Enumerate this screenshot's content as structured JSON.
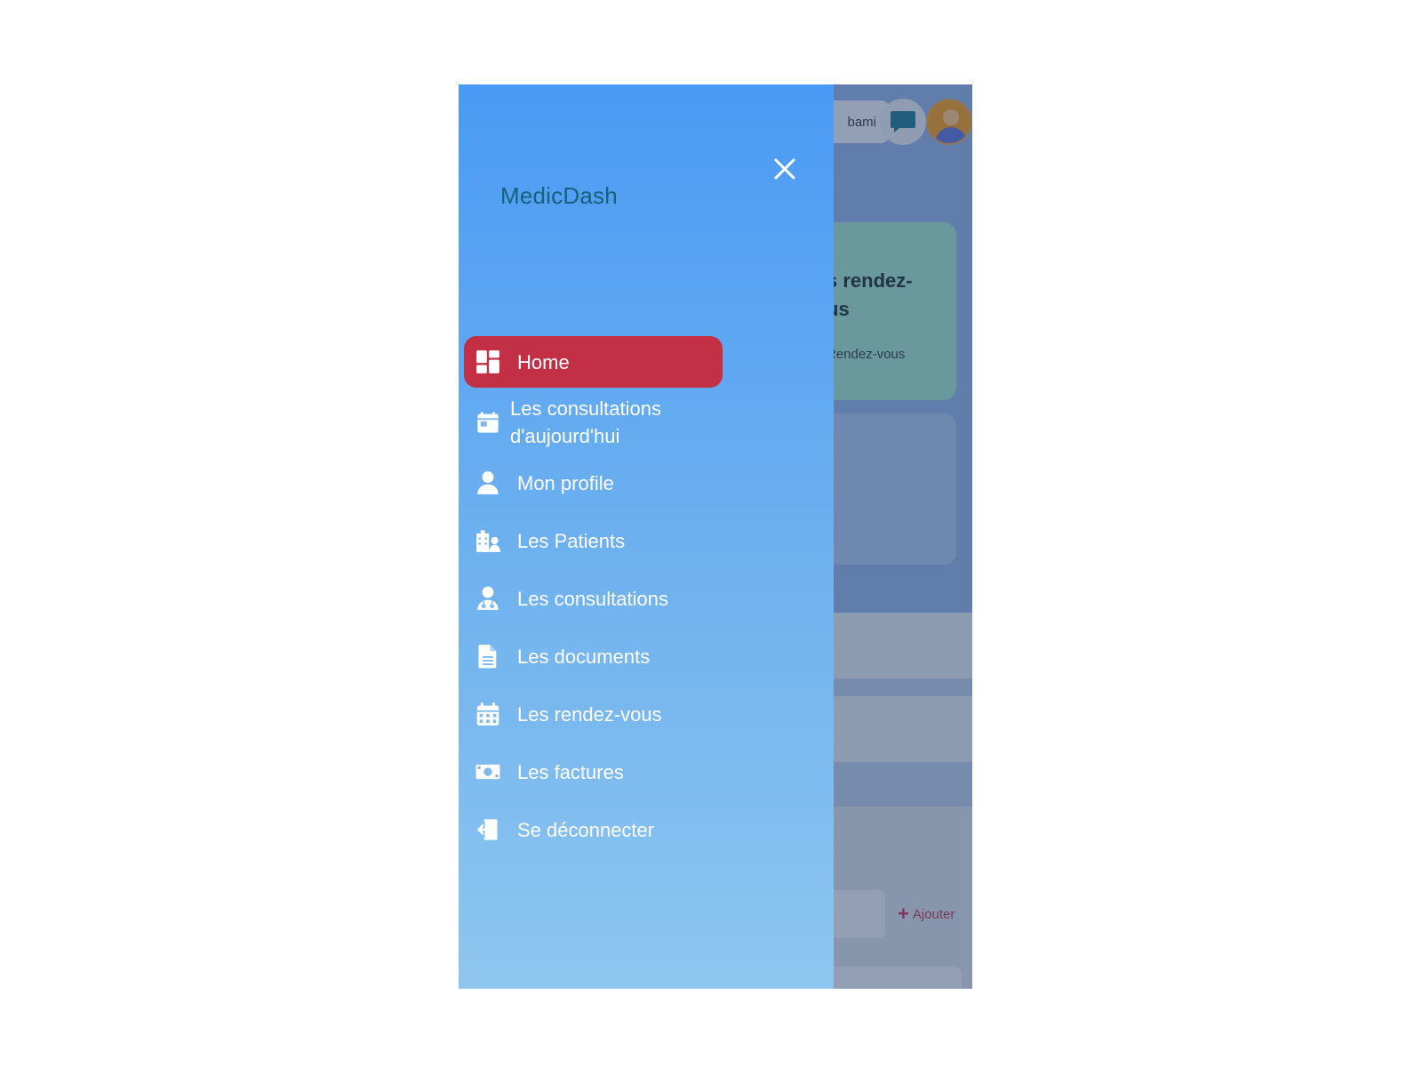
{
  "background_app": {
    "user_name_partial": "bami",
    "card_title_partial": "s rendez-\nus",
    "card_subtitle_partial": "Rendez-vous",
    "add_button_label": "Ajouter"
  },
  "drawer": {
    "brand": "MedicDash",
    "items": [
      {
        "label": "Home",
        "icon": "dashboard-icon",
        "active": true
      },
      {
        "label": "Les consultations\nd'aujourd'hui",
        "icon": "calendar-day-icon"
      },
      {
        "label": "Mon profile",
        "icon": "user-icon"
      },
      {
        "label": "Les Patients",
        "icon": "hospital-user-icon"
      },
      {
        "label": "Les consultations",
        "icon": "user-doctor-icon"
      },
      {
        "label": "Les documents",
        "icon": "file-icon"
      },
      {
        "label": "Les rendez-vous",
        "icon": "calendar-icon"
      },
      {
        "label": "Les factures",
        "icon": "money-bill-icon"
      },
      {
        "label": "Se déconnecter",
        "icon": "sign-out-icon"
      }
    ]
  },
  "colors": {
    "active_item": "#c33046",
    "brand_text": "#16617d",
    "drawer_top": "#4a9af5",
    "drawer_bottom": "#8ec6ef"
  }
}
